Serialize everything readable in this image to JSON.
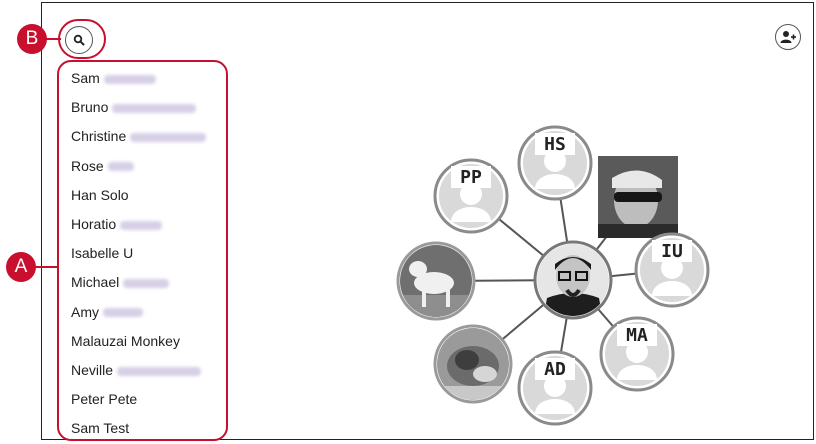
{
  "toolbar": {
    "search_icon": "search-icon",
    "add_person_icon": "add-person-icon"
  },
  "callouts": {
    "a_label": "A",
    "b_label": "B",
    "color": "#c8102e"
  },
  "contacts": [
    {
      "first": "Sam",
      "last_blurred": true
    },
    {
      "first": "Bruno",
      "last_blurred": true
    },
    {
      "first": "Christine",
      "last_blurred": true
    },
    {
      "first": "Rose",
      "last_blurred": true
    },
    {
      "first": "Han Solo",
      "last_blurred": false
    },
    {
      "first": "Horatio",
      "last_blurred": true
    },
    {
      "first": "Isabelle U",
      "last_blurred": false
    },
    {
      "first": "Michael",
      "last_blurred": true
    },
    {
      "first": "Amy",
      "last_blurred": true
    },
    {
      "first": "Malauzai Monkey",
      "last_blurred": false
    },
    {
      "first": "Neville",
      "last_blurred": true
    },
    {
      "first": "Peter Pete",
      "last_blurred": false
    },
    {
      "first": "Sam Test",
      "last_blurred": false
    }
  ],
  "network": {
    "center": {
      "type": "photo",
      "subject": "man-with-glasses"
    },
    "nodes": [
      {
        "initials": "HS",
        "type": "placeholder"
      },
      {
        "initials": "",
        "type": "photo",
        "subject": "man-with-sunglasses"
      },
      {
        "initials": "IU",
        "type": "placeholder"
      },
      {
        "initials": "MA",
        "type": "placeholder"
      },
      {
        "initials": "AD",
        "type": "placeholder"
      },
      {
        "initials": "",
        "type": "photo",
        "subject": "puppy"
      },
      {
        "initials": "",
        "type": "photo",
        "subject": "white-dog"
      },
      {
        "initials": "PP",
        "type": "placeholder"
      }
    ]
  }
}
